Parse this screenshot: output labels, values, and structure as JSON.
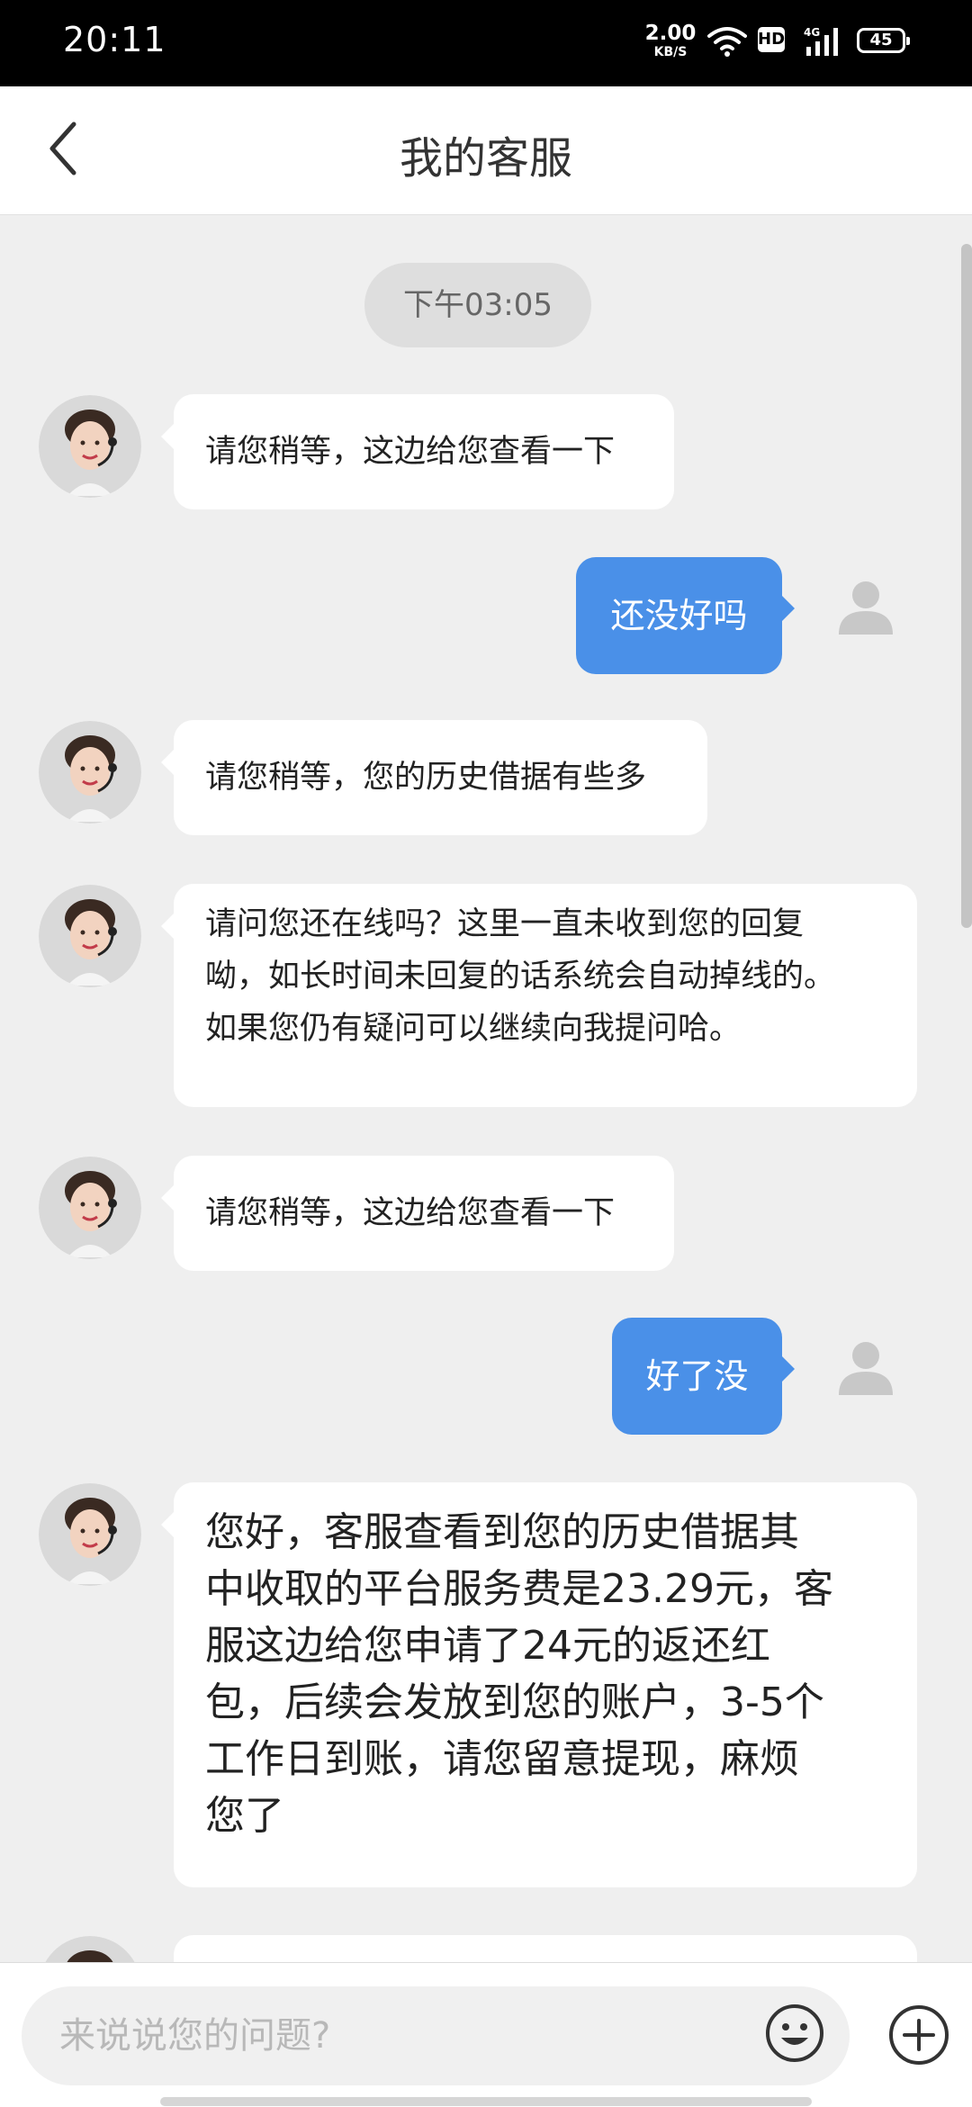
{
  "status_bar": {
    "time": "20:11",
    "net_rate": "2.00",
    "net_unit": "KB/S",
    "hd": "HD",
    "network": "4G",
    "battery": "45"
  },
  "header": {
    "title": "我的客服"
  },
  "timestamp": "下午03:05",
  "messages": [
    {
      "from": "agent",
      "text": "请您稍等，这边给您查看一下"
    },
    {
      "from": "user",
      "text": "还没好吗"
    },
    {
      "from": "agent",
      "text": "请您稍等，您的历史借据有些多"
    },
    {
      "from": "agent",
      "lines": [
        "请问您还在线吗？这里一直未收到您的回复",
        "呦，如长时间未回复的话系统会自动掉线的。",
        "如果您仍有疑问可以继续向我提问哈。"
      ]
    },
    {
      "from": "agent",
      "text": "请您稍等，这边给您查看一下"
    },
    {
      "from": "user",
      "text": "好了没"
    },
    {
      "from": "agent",
      "lines": [
        "您好，客服查看到您的历史借据其",
        "中收取的平台服务费是23.29元，客",
        "服这边给您申请了24元的返还红",
        "包，后续会发放到您的账户，3-5个",
        "工作日到账，请您留意提现，麻烦",
        "您了"
      ]
    }
  ],
  "input": {
    "placeholder": "来说说您的问题?"
  },
  "icons": {
    "back": "chevron-left-icon",
    "agent_avatar": "agent-avatar",
    "user_avatar": "user-icon",
    "emoji": "emoji-icon",
    "more": "plus-circle-icon"
  },
  "colors": {
    "user_bubble": "#4a90e8",
    "agent_bubble": "#ffffff",
    "chat_bg": "#efefef"
  }
}
